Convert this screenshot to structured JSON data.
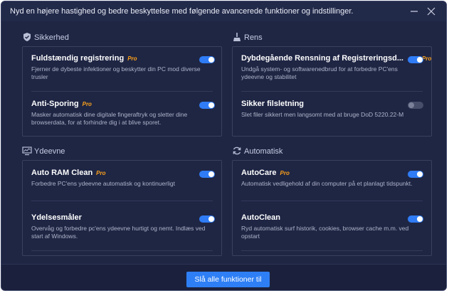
{
  "window": {
    "title": "Nyd en højere hastighed og bedre beskyttelse med følgende avancerede funktioner og indstillinger.",
    "minimize_icon": "minimize-icon",
    "close_icon": "close-icon"
  },
  "pro_label": "Pro",
  "sections": {
    "security": {
      "label": "Sikkerhed",
      "icon": "shield-icon",
      "items": [
        {
          "title": "Fuldstændig registrering",
          "pro": true,
          "desc": "Fjerner de dybeste infektioner og beskytter din PC mod diverse trusler",
          "enabled": true
        },
        {
          "title": "Anti-Sporing",
          "pro": true,
          "desc": "Masker automatisk dine digitale fingeraftryk og sletter dine browserdata, for at forhindre dig i at blive sporet.",
          "enabled": true
        }
      ]
    },
    "clean": {
      "label": "Rens",
      "icon": "broom-icon",
      "items": [
        {
          "title": "Dybdegående Rensning af Registreringsd...",
          "pro": true,
          "desc": "Undgå system- og softwarenedbrud for at forbedre PC'ens ydeevne og stabilitet",
          "enabled": true
        },
        {
          "title": "Sikker filsletning",
          "pro": false,
          "desc": "Slet filer sikkert men langsomt med at bruge DoD 5220.22-M",
          "enabled": false
        }
      ]
    },
    "performance": {
      "label": "Ydeevne",
      "icon": "monitor-icon",
      "items": [
        {
          "title": "Auto RAM Clean",
          "pro": true,
          "desc": "Forbedre PC'ens ydeevne automatisk og kontinuerligt",
          "enabled": true
        },
        {
          "title": "Ydelsesmåler",
          "pro": false,
          "desc": "Overvåg og forbedre pc'ens ydeevne hurtigt og nemt. Indlæs ved start af Windows.",
          "enabled": true
        }
      ]
    },
    "automatic": {
      "label": "Automatisk",
      "icon": "refresh-icon",
      "items": [
        {
          "title": "AutoCare",
          "pro": true,
          "desc": "Automatisk vedligehold af din computer på et planlagt tidspunkt.",
          "enabled": true
        },
        {
          "title": "AutoClean",
          "pro": false,
          "desc": "Ryd automatisk surf historik, cookies, browser cache m.m. ved opstart",
          "enabled": true
        }
      ]
    }
  },
  "footer": {
    "enable_all_label": "Slå alle funktioner til"
  },
  "colors": {
    "background": "#1f2644",
    "accent": "#2e7ff5",
    "pro": "#ffa21a",
    "toggle_off": "#464e6a"
  }
}
